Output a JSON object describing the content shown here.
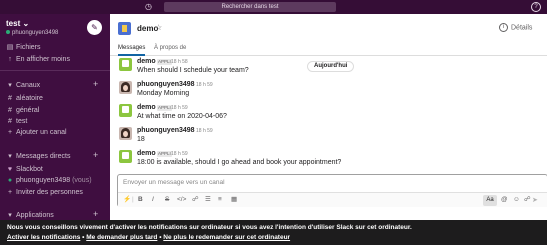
{
  "topbar": {
    "search_placeholder": "Rechercher dans test"
  },
  "workspace": {
    "name": "test",
    "user": "phuonguyen3498"
  },
  "sidebar": {
    "files": "Fichiers",
    "show_less": "En afficher moins",
    "channels_header": "Canaux",
    "channels": [
      "aléatoire",
      "général",
      "test"
    ],
    "add_channel": "Ajouter un canal",
    "dm_header": "Messages directs",
    "dms": [
      "Slackbot",
      "phuonguyen3498"
    ],
    "dm_you": "(vous)",
    "invite": "Inviter des personnes",
    "apps_header": "Applications"
  },
  "channel": {
    "name": "demo",
    "details": "Détails",
    "tabs": [
      "Messages",
      "À propos de"
    ]
  },
  "messages": [
    {
      "author": "demo",
      "tag": "APPLI",
      "time": "18 h 58",
      "text": "When should I schedule your team?"
    },
    {
      "author": "phuonguyen3498",
      "tag": "",
      "time": "18 h 59",
      "text": "Monday Morning"
    },
    {
      "author": "demo",
      "tag": "APPLI",
      "time": "18 h 59",
      "text": "At what time on 2020-04-06?"
    },
    {
      "author": "phuonguyen3498",
      "tag": "",
      "time": "18 h 59",
      "text": "18"
    },
    {
      "author": "demo",
      "tag": "APPLI",
      "time": "18 h 59",
      "text": "18:00 is available, should I go ahead and book your appointment?"
    }
  ],
  "date_divider": "Aujourd'hui",
  "composer": {
    "placeholder": "Envoyer un message vers un canal",
    "aa": "Aa"
  },
  "banner": {
    "line1": "Nous vous conseillons vivement d'activer les notifications sur ordinateur si vous avez l'intention d'utiliser Slack sur cet ordinateur.",
    "enable": "Activer les notifications",
    "later": "Me demander plus tard",
    "never": "Ne plus le redemander sur cet ordinateur"
  }
}
